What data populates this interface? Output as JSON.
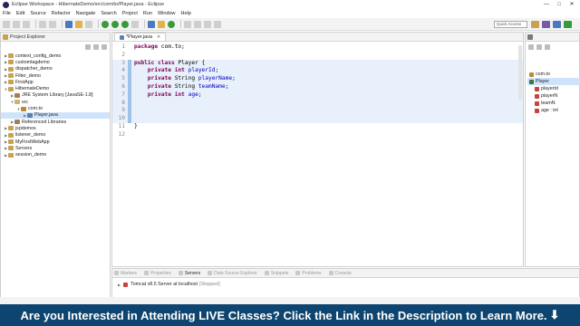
{
  "window": {
    "title": "Eclipse Workspace - HibernateDemo/src/com/to/Player.java - Eclipse",
    "controls": [
      "—",
      "□",
      "✕"
    ]
  },
  "menu": [
    "File",
    "Edit",
    "Source",
    "Refactor",
    "Navigate",
    "Search",
    "Project",
    "Run",
    "Window",
    "Help"
  ],
  "toolbar": {
    "quick_access_placeholder": "Quick Access"
  },
  "project_explorer": {
    "title": "Project Explorer",
    "tree": [
      {
        "label": "context_config_demo",
        "depth": 0,
        "arrow": "▶",
        "icon": "project-icon"
      },
      {
        "label": "customtagdemo",
        "depth": 0,
        "arrow": "▶",
        "icon": "project-icon"
      },
      {
        "label": "dispatcher_demo",
        "depth": 0,
        "arrow": "▶",
        "icon": "project-icon"
      },
      {
        "label": "Filter_demo",
        "depth": 0,
        "arrow": "▶",
        "icon": "project-icon"
      },
      {
        "label": "FirstApp",
        "depth": 0,
        "arrow": "▶",
        "icon": "project-icon"
      },
      {
        "label": "HibernateDemo",
        "depth": 0,
        "arrow": "▼",
        "icon": "project-icon"
      },
      {
        "label": "JRE System Library [JavaSE-1.8]",
        "depth": 1,
        "arrow": "▶",
        "icon": "library-icon"
      },
      {
        "label": "src",
        "depth": 1,
        "arrow": "▼",
        "icon": "source-folder-icon"
      },
      {
        "label": "com.to",
        "depth": 2,
        "arrow": "▼",
        "icon": "package-icon"
      },
      {
        "label": "Player.java",
        "depth": 3,
        "arrow": "▶",
        "icon": "java-file-icon",
        "selected": true
      },
      {
        "label": "Referenced Libraries",
        "depth": 1,
        "arrow": "▶",
        "icon": "library-icon"
      },
      {
        "label": "jspdemos",
        "depth": 0,
        "arrow": "▶",
        "icon": "project-icon"
      },
      {
        "label": "listener_demo",
        "depth": 0,
        "arrow": "▶",
        "icon": "project-icon"
      },
      {
        "label": "MyFirstWebApp",
        "depth": 0,
        "arrow": "▶",
        "icon": "project-icon"
      },
      {
        "label": "Servers",
        "depth": 0,
        "arrow": "▶",
        "icon": "project-icon"
      },
      {
        "label": "session_demo",
        "depth": 0,
        "arrow": "▶",
        "icon": "project-icon"
      }
    ]
  },
  "editor": {
    "tab_label": "*Player.java",
    "lines": [
      {
        "n": "1",
        "tokens": [
          {
            "t": "package",
            "c": "kw"
          },
          {
            "t": " com.to;",
            "c": ""
          }
        ]
      },
      {
        "n": "2",
        "tokens": []
      },
      {
        "n": "3",
        "tokens": [
          {
            "t": "public",
            "c": "kw"
          },
          {
            "t": " ",
            "c": ""
          },
          {
            "t": "class",
            "c": "kw"
          },
          {
            "t": " Player {",
            "c": ""
          }
        ],
        "hl": true
      },
      {
        "n": "4",
        "tokens": [
          {
            "t": "    ",
            "c": ""
          },
          {
            "t": "private",
            "c": "kw"
          },
          {
            "t": " ",
            "c": ""
          },
          {
            "t": "int",
            "c": "kw"
          },
          {
            "t": " ",
            "c": ""
          },
          {
            "t": "playerId",
            "c": "fld"
          },
          {
            "t": ";",
            "c": ""
          }
        ],
        "hl": true
      },
      {
        "n": "5",
        "tokens": [
          {
            "t": "    ",
            "c": ""
          },
          {
            "t": "private",
            "c": "kw"
          },
          {
            "t": " String ",
            "c": ""
          },
          {
            "t": "playerName",
            "c": "fld"
          },
          {
            "t": ";",
            "c": ""
          }
        ],
        "hl": true
      },
      {
        "n": "6",
        "tokens": [
          {
            "t": "    ",
            "c": ""
          },
          {
            "t": "private",
            "c": "kw"
          },
          {
            "t": " String ",
            "c": ""
          },
          {
            "t": "teamName",
            "c": "fld"
          },
          {
            "t": ";",
            "c": ""
          }
        ],
        "hl": true
      },
      {
        "n": "7",
        "tokens": [
          {
            "t": "    ",
            "c": ""
          },
          {
            "t": "private",
            "c": "kw"
          },
          {
            "t": " ",
            "c": ""
          },
          {
            "t": "int",
            "c": "kw"
          },
          {
            "t": " ",
            "c": ""
          },
          {
            "t": "age",
            "c": "fld"
          },
          {
            "t": ";",
            "c": ""
          }
        ],
        "hl": true
      },
      {
        "n": "8",
        "tokens": [],
        "hl": true
      },
      {
        "n": "9",
        "tokens": [],
        "hl": true
      },
      {
        "n": "10",
        "tokens": [],
        "hl": true
      },
      {
        "n": "11",
        "tokens": [
          {
            "t": "}",
            "c": ""
          }
        ]
      },
      {
        "n": "12",
        "tokens": []
      }
    ]
  },
  "outline": {
    "items": [
      {
        "label": "com.to",
        "color": "#b88a3a"
      },
      {
        "label": "Player",
        "color": "#3a7a3a",
        "selected": true
      },
      {
        "label": "playerId",
        "color": "#c7433b"
      },
      {
        "label": "playerN",
        "color": "#c7433b"
      },
      {
        "label": "teamN",
        "color": "#c7433b"
      },
      {
        "label": "age : int",
        "color": "#c7433b"
      }
    ]
  },
  "bottom_panel": {
    "tabs": [
      {
        "label": "Markers",
        "active": false
      },
      {
        "label": "Properties",
        "active": false
      },
      {
        "label": "Servers",
        "active": true
      },
      {
        "label": "Data Source Explorer",
        "active": false
      },
      {
        "label": "Snippets",
        "active": false
      },
      {
        "label": "Problems",
        "active": false
      },
      {
        "label": "Console",
        "active": false
      }
    ],
    "server_row": {
      "name": "Tomcat v8.5 Server at localhost",
      "status": "[Stopped]"
    }
  },
  "banner": {
    "text": "Are you Interested in Attending LIVE Classes? Click the Link in the Description to Learn More.",
    "arrow": "⬇"
  },
  "colors": {
    "banner_bg": "#0d4470",
    "keyword": "#7f0055",
    "field": "#0000c0"
  }
}
